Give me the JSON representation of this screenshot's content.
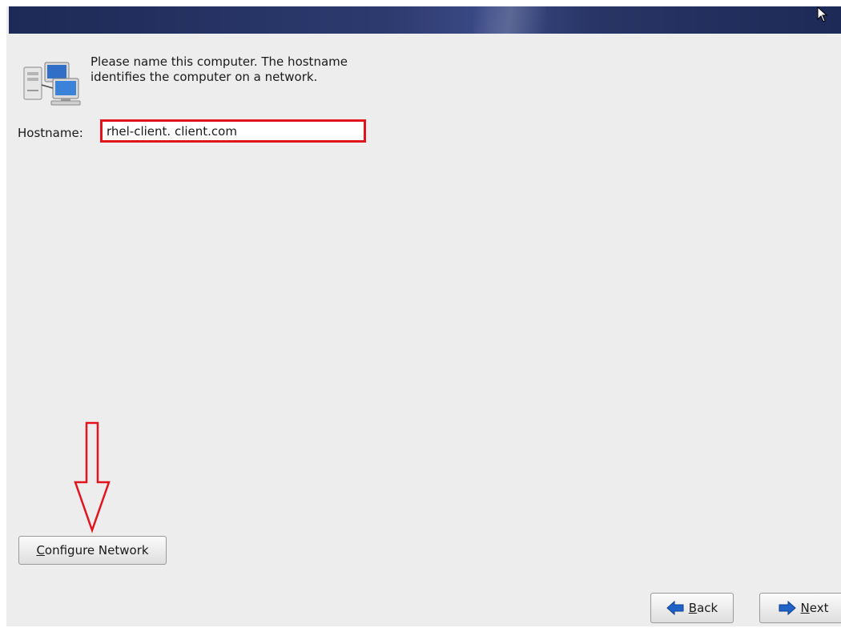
{
  "intro_text": "Please name this computer.  The hostname identifies the computer on a network.",
  "hostname": {
    "label": "Hostname:",
    "value": "rhel-client. client.com"
  },
  "buttons": {
    "configure_network": {
      "mnemonic": "C",
      "rest": "onfigure Network"
    },
    "back": {
      "mnemonic": "B",
      "rest": "ack"
    },
    "next": {
      "mnemonic": "N",
      "rest": "ext"
    }
  },
  "icons": {
    "computer": "network-computer-icon",
    "back": "arrow-left-icon",
    "next": "arrow-right-icon",
    "cursor": "mouse-cursor-icon",
    "annotation": "down-arrow-annotation"
  },
  "colors": {
    "banner": "#1d2956",
    "highlight": "#e1141e",
    "arrow_blue": "#1f63c9",
    "background": "#ededed"
  }
}
